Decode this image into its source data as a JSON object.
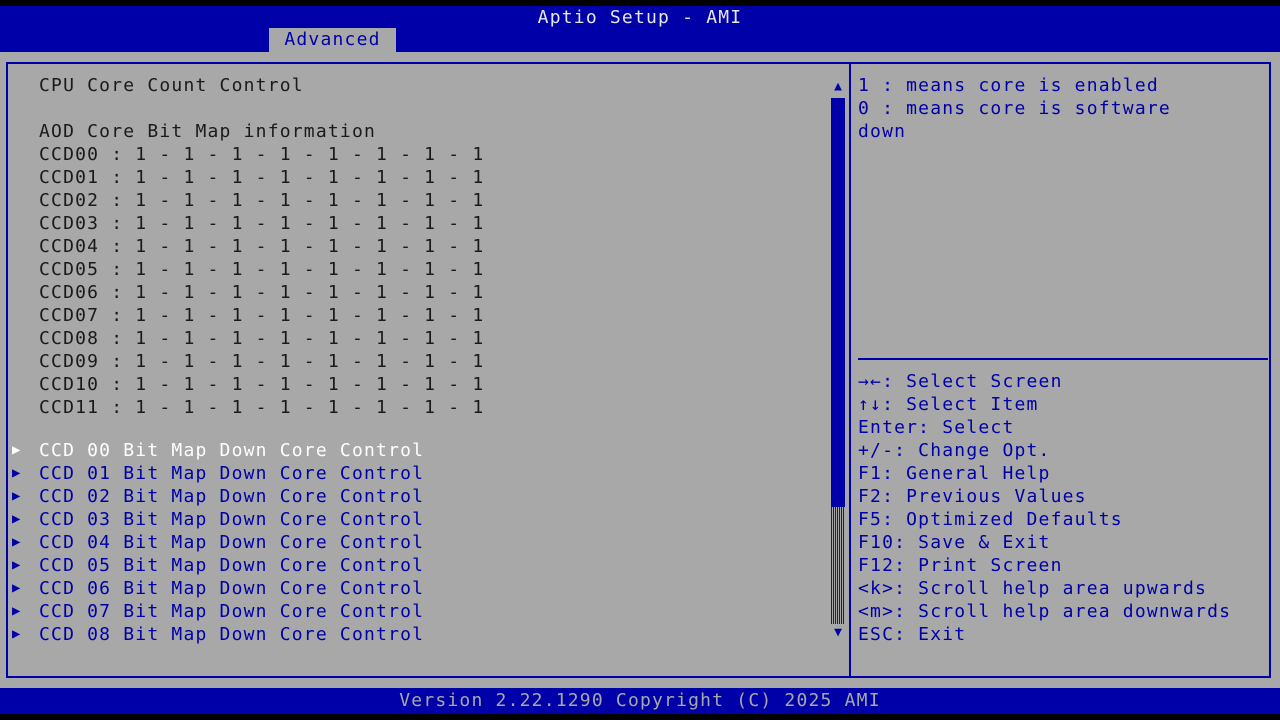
{
  "header": {
    "title": "Aptio Setup - AMI",
    "active_tab": "Advanced"
  },
  "main": {
    "title": "CPU Core Count Control",
    "section_label": "AOD Core Bit Map information",
    "ccd_rows": [
      "CCD00 : 1 - 1 - 1 - 1 - 1 - 1 - 1 - 1",
      "CCD01 : 1 - 1 - 1 - 1 - 1 - 1 - 1 - 1",
      "CCD02 : 1 - 1 - 1 - 1 - 1 - 1 - 1 - 1",
      "CCD03 : 1 - 1 - 1 - 1 - 1 - 1 - 1 - 1",
      "CCD04 : 1 - 1 - 1 - 1 - 1 - 1 - 1 - 1",
      "CCD05 : 1 - 1 - 1 - 1 - 1 - 1 - 1 - 1",
      "CCD06 : 1 - 1 - 1 - 1 - 1 - 1 - 1 - 1",
      "CCD07 : 1 - 1 - 1 - 1 - 1 - 1 - 1 - 1",
      "CCD08 : 1 - 1 - 1 - 1 - 1 - 1 - 1 - 1",
      "CCD09 : 1 - 1 - 1 - 1 - 1 - 1 - 1 - 1",
      "CCD10 : 1 - 1 - 1 - 1 - 1 - 1 - 1 - 1",
      "CCD11 : 1 - 1 - 1 - 1 - 1 - 1 - 1 - 1"
    ],
    "submenus": [
      "CCD 00 Bit Map Down Core Control",
      "CCD 01 Bit Map Down Core Control",
      "CCD 02 Bit Map Down Core Control",
      "CCD 03 Bit Map Down Core Control",
      "CCD 04 Bit Map Down Core Control",
      "CCD 05 Bit Map Down Core Control",
      "CCD 06 Bit Map Down Core Control",
      "CCD 07 Bit Map Down Core Control",
      "CCD 08 Bit Map Down Core Control"
    ],
    "selected_index": 0,
    "submenu_arrow_icon": "triangle-right-icon"
  },
  "scrollbar": {
    "up_icon": "scroll-up-arrow-icon",
    "down_icon": "scroll-down-arrow-icon"
  },
  "help": {
    "lines": [
      "1 : means core is enabled",
      "0 : means core is software",
      "down"
    ]
  },
  "keys": [
    "→←: Select Screen",
    "↑↓: Select Item",
    "Enter: Select",
    "+/-: Change Opt.",
    "F1: General Help",
    "F2: Previous Values",
    "F5: Optimized Defaults",
    "F10: Save & Exit",
    "F12: Print Screen",
    "<k>: Scroll help area upwards",
    "<m>: Scroll help area downwards",
    "ESC: Exit"
  ],
  "footer": {
    "version": "Version 2.22.1290 Copyright (C) 2025 AMI"
  },
  "colors": {
    "background": "#a8a8a8",
    "accent": "#0000a8",
    "selected_text": "#ffffff",
    "static_text": "#1a1a1a"
  }
}
